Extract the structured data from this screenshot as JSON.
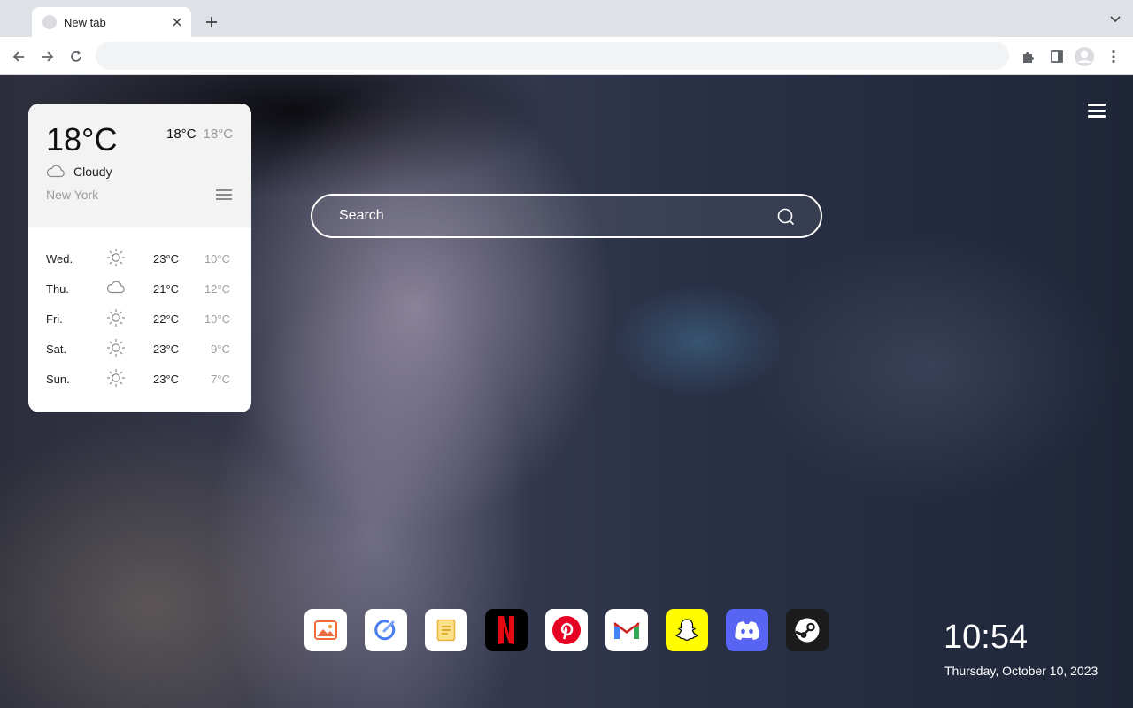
{
  "browser": {
    "tab": {
      "title": "New tab"
    },
    "omnibox": {
      "value": "",
      "placeholder": ""
    }
  },
  "search": {
    "placeholder": "Search"
  },
  "weather": {
    "current_temp": "18°C",
    "high": "18°C",
    "low": "18°C",
    "condition": "Cloudy",
    "condition_icon": "cloud-icon",
    "city": "New York",
    "forecast": [
      {
        "day": "Wed.",
        "icon": "sun-icon",
        "high": "23°C",
        "low": "10°C"
      },
      {
        "day": "Thu.",
        "icon": "cloud-icon",
        "high": "21°C",
        "low": "12°C"
      },
      {
        "day": "Fri.",
        "icon": "sun-icon",
        "high": "22°C",
        "low": "10°C"
      },
      {
        "day": "Sat.",
        "icon": "sun-icon",
        "high": "23°C",
        "low": "9°C"
      },
      {
        "day": "Sun.",
        "icon": "sun-icon",
        "high": "23°C",
        "low": "7°C"
      }
    ]
  },
  "shortcuts": [
    {
      "name": "photos-app-icon",
      "bg": "#ffffff"
    },
    {
      "name": "tasks-app-icon",
      "bg": "#ffffff"
    },
    {
      "name": "notes-app-icon",
      "bg": "#ffffff"
    },
    {
      "name": "netflix-icon",
      "bg": "#000000"
    },
    {
      "name": "pinterest-icon",
      "bg": "#ffffff"
    },
    {
      "name": "gmail-icon",
      "bg": "#ffffff"
    },
    {
      "name": "snapchat-icon",
      "bg": "#fffc00"
    },
    {
      "name": "discord-icon",
      "bg": "#5865f2"
    },
    {
      "name": "steam-icon",
      "bg": "#1b1b1b"
    }
  ],
  "clock": {
    "time": "10:54",
    "date": "Thursday, October 10, 2023"
  }
}
